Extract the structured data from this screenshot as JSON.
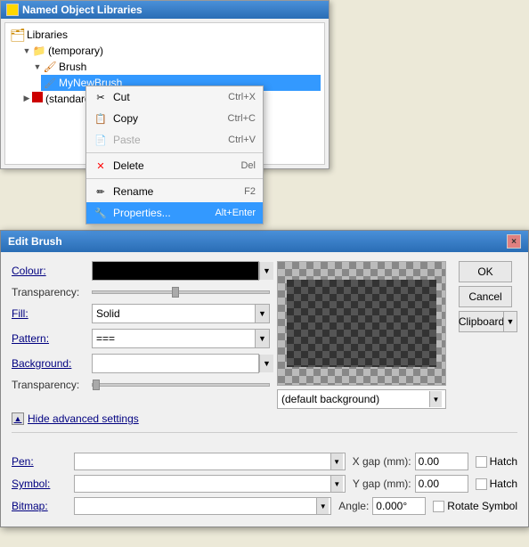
{
  "nol": {
    "title": "Named Object Libraries",
    "tree": {
      "libraries_label": "Libraries",
      "temporary_label": "(temporary)",
      "brush_label": "Brush",
      "mynewbrush_label": "MyNewBrush",
      "standard_label": "(standard)"
    }
  },
  "context_menu": {
    "cut_label": "Cut",
    "cut_shortcut": "Ctrl+X",
    "copy_label": "Copy",
    "copy_shortcut": "Ctrl+C",
    "paste_label": "Paste",
    "paste_shortcut": "Ctrl+V",
    "delete_label": "Delete",
    "delete_shortcut": "Del",
    "rename_label": "Rename",
    "rename_shortcut": "F2",
    "properties_label": "Properties...",
    "properties_shortcut": "Alt+Enter"
  },
  "edit_brush": {
    "title": "Edit Brush",
    "close_label": "×",
    "colour_label": "Colour:",
    "transparency_label": "Transparency:",
    "fill_label": "Fill:",
    "fill_value": "Solid",
    "pattern_label": "Pattern:",
    "pattern_value": "===",
    "background_label": "Background:",
    "bg_transparency_label": "Transparency:",
    "bg_default_label": "(default background)",
    "hide_advanced_label": "Hide advanced settings",
    "pen_label": "Pen:",
    "symbol_label": "Symbol:",
    "bitmap_label": "Bitmap:",
    "x_gap_label": "X gap (mm):",
    "x_gap_value": "0.00",
    "y_gap_label": "Y gap (mm):",
    "y_gap_value": "0.00",
    "angle_label": "Angle:",
    "angle_value": "0.000°",
    "hatch_label_1": "Hatch",
    "hatch_label_2": "Hatch",
    "rotate_symbol_label": "Rotate Symbol",
    "ok_label": "OK",
    "cancel_label": "Cancel",
    "clipboard_label": "Clipboard"
  }
}
